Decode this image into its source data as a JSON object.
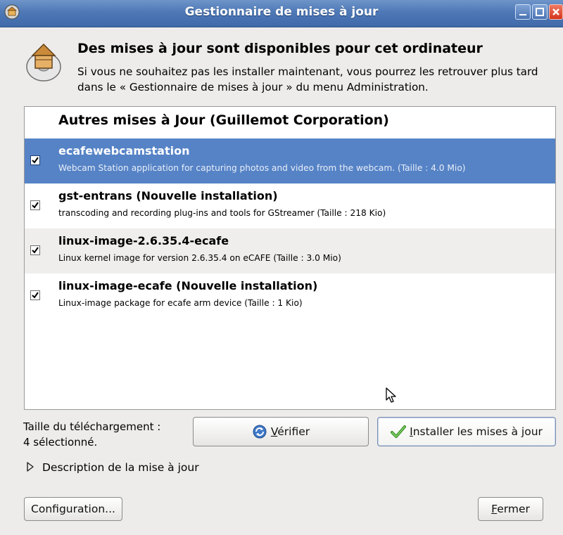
{
  "window": {
    "title": "Gestionnaire de mises à jour"
  },
  "header": {
    "title": "Des mises à jour sont disponibles pour cet ordinateur",
    "description": "Si vous ne souhaitez pas les installer maintenant, vous pourrez les retrouver plus tard dans le « Gestionnaire de mises à jour » du menu Administration."
  },
  "updates": {
    "group_title": "Autres mises à Jour (Guillemot Corporation)",
    "items": [
      {
        "name": "ecafewebcamstation",
        "description": "Webcam Station application for capturing photos and video from the webcam. (Taille : 4.0 Mio)",
        "checked": true,
        "selected": true
      },
      {
        "name": "gst-entrans (Nouvelle installation)",
        "description": "transcoding and recording plug-ins and tools for GStreamer (Taille : 218 Kio)",
        "checked": true,
        "selected": false
      },
      {
        "name": "linux-image-2.6.35.4-ecafe",
        "description": "Linux kernel image for version 2.6.35.4 on eCAFE (Taille : 3.0 Mio)",
        "checked": true,
        "selected": false
      },
      {
        "name": "linux-image-ecafe (Nouvelle installation)",
        "description": "Linux-image package for ecafe arm device (Taille : 1 Kio)",
        "checked": true,
        "selected": false
      }
    ]
  },
  "download": {
    "size_label": "Taille du téléchargement :",
    "selected_count": "4 sélectionné."
  },
  "buttons": {
    "verify_mnemonic": "V",
    "verify_rest": "érifier",
    "install_mnemonic": "I",
    "install_rest": "nstaller les mises à jour",
    "config": "Configuration...",
    "close_mnemonic": "F",
    "close_rest": "ermer"
  },
  "expander": {
    "label": "Description de la mise à jour"
  },
  "colors": {
    "titlebar": "#4e78b6",
    "selection": "#5683c6",
    "window_bg": "#edeceb"
  },
  "icons": {
    "app": "update-manager-icon",
    "header": "software-update-icon",
    "verify": "refresh-icon",
    "install": "checkmark-icon"
  }
}
